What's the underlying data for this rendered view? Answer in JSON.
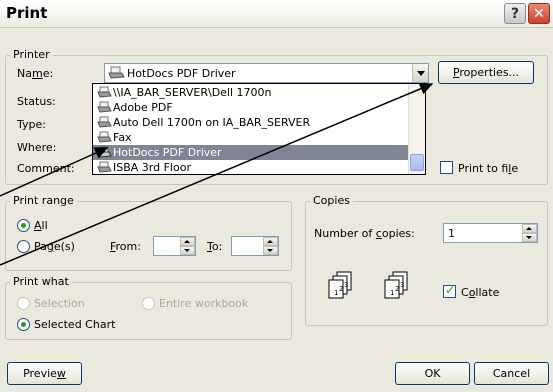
{
  "window": {
    "title": "Print",
    "help_glyph": "?",
    "close_glyph": "✕"
  },
  "printer": {
    "legend": "Printer",
    "name_label": "Name:",
    "selected_printer": "HotDocs PDF Driver",
    "status_label": "Status:",
    "type_label": "Type:",
    "where_label": "Where:",
    "comment_label": "Comment:",
    "properties_label": "Properties...",
    "print_to_file_label": "Print to file",
    "print_to_file_checked": false,
    "printer_options": [
      "\\\\IA_BAR_SERVER\\Dell 1700n",
      "Adobe PDF",
      "Auto Dell 1700n on IA_BAR_SERVER",
      "Fax",
      "HotDocs PDF Driver",
      "ISBA 3rd Floor"
    ],
    "highlighted_index": 4
  },
  "print_range": {
    "legend": "Print range",
    "all_label": "All",
    "pages_label": "Page(s)",
    "from_label": "From:",
    "to_label": "To:",
    "from_value": "",
    "to_value": "",
    "selected": "all"
  },
  "copies": {
    "legend": "Copies",
    "number_label": "Number of copies:",
    "number_value": "1",
    "collate_label": "Collate",
    "collate_checked": true
  },
  "print_what": {
    "legend": "Print what",
    "selection_label": "Selection",
    "entire_workbook_label": "Entire workbook",
    "selected_chart_label": "Selected Chart",
    "selected": "selected-chart"
  },
  "footer": {
    "preview_label": "Preview",
    "ok_label": "OK",
    "cancel_label": "Cancel"
  }
}
